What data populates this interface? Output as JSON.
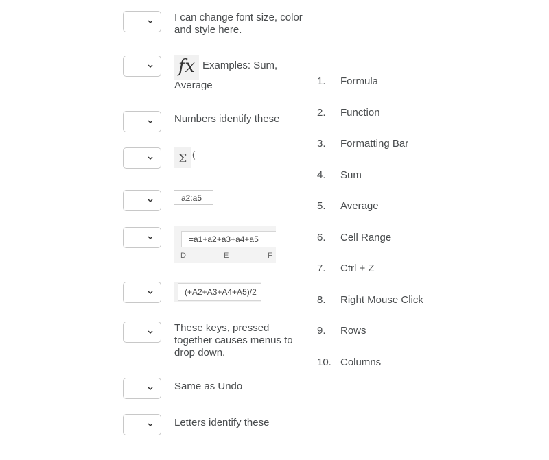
{
  "prompts": [
    {
      "text": "I can change font size, color and style here.",
      "selected": ""
    },
    {
      "icon": "fx-icon",
      "icon_glyph": "fx",
      "text": "Examples: Sum,",
      "text2": "Average",
      "selected": ""
    },
    {
      "text": "Numbers identify these",
      "selected": ""
    },
    {
      "icon": "sigma-icon",
      "icon_glyph": "Σ",
      "icon_suffix": "(",
      "selected": ""
    },
    {
      "image_text": "a2:a5",
      "selected": ""
    },
    {
      "image_text": "=a1+a2+a3+a4+a5",
      "columns": [
        "D",
        "E",
        "F"
      ],
      "selected": ""
    },
    {
      "image_text": "(+A2+A3+A4+A5)/2",
      "selected": ""
    },
    {
      "text": "These keys, pressed together causes menus to drop down.",
      "selected": ""
    },
    {
      "text": "Same as Undo",
      "selected": ""
    },
    {
      "text": "Letters identify these",
      "selected": ""
    }
  ],
  "answers": [
    {
      "num": "1.",
      "label": "Formula"
    },
    {
      "num": "2.",
      "label": "Function"
    },
    {
      "num": "3.",
      "label": "Formatting Bar"
    },
    {
      "num": "4.",
      "label": "Sum"
    },
    {
      "num": "5.",
      "label": "Average"
    },
    {
      "num": "6.",
      "label": "Cell Range"
    },
    {
      "num": "7.",
      "label": "Ctrl + Z"
    },
    {
      "num": "8.",
      "label": "Right Mouse Click"
    },
    {
      "num": "9.",
      "label": "Rows"
    },
    {
      "num": "10.",
      "label": "Columns"
    }
  ]
}
